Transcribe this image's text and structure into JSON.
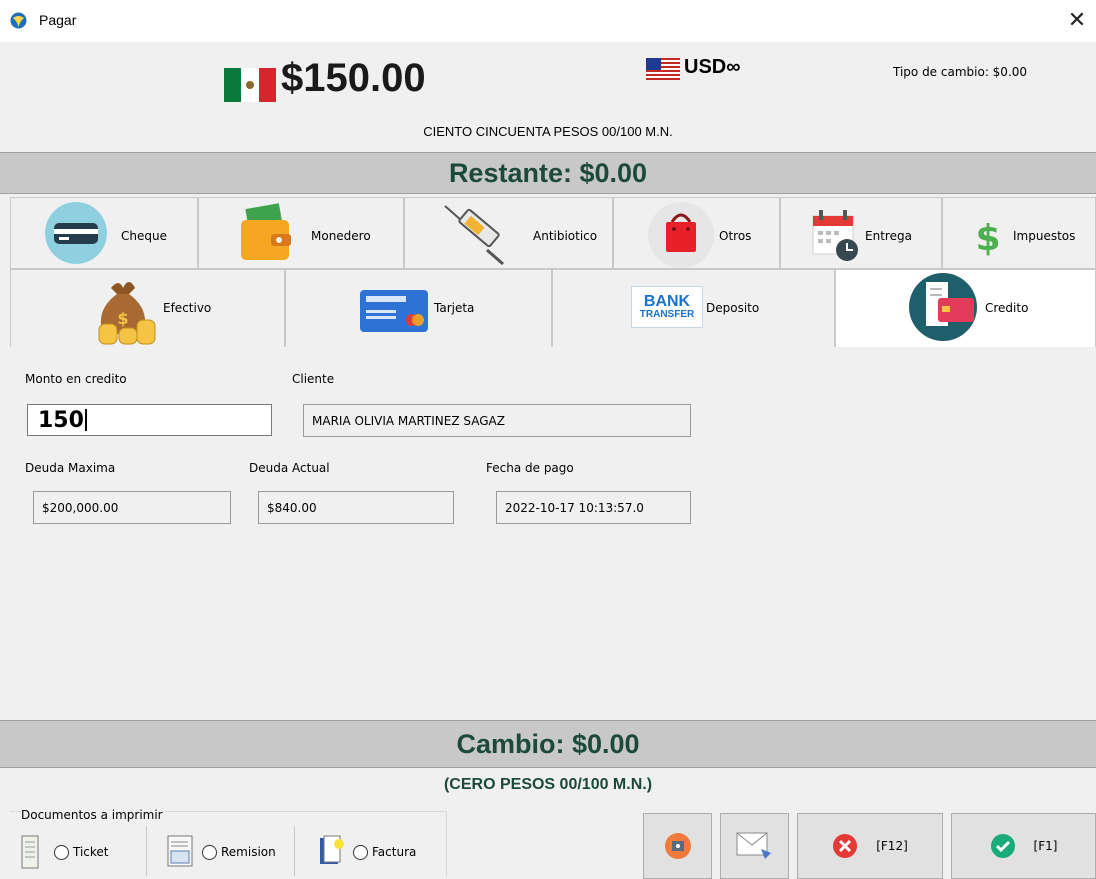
{
  "window": {
    "title": "Pagar",
    "close_glyph": "✕"
  },
  "header": {
    "total": "$150.00",
    "currency": "USD∞",
    "exchange_rate": "Tipo de cambio: $0.00",
    "amount_words": "CIENTO CINCUENTA PESOS  00/100 M.N."
  },
  "restante": "Restante: $0.00",
  "tabs_top": [
    {
      "label": "Cheque",
      "icon": "check-card-icon"
    },
    {
      "label": "Monedero",
      "icon": "wallet-icon"
    },
    {
      "label": "Antibiotico",
      "icon": "syringe-icon"
    },
    {
      "label": "Otros",
      "icon": "shopping-bag-icon"
    },
    {
      "label": "Entrega",
      "icon": "calendar-clock-icon"
    },
    {
      "label": "Impuestos",
      "icon": "dollar-icon"
    }
  ],
  "tabs_bottom": [
    {
      "label": "Efectivo",
      "icon": "money-bag-icon"
    },
    {
      "label": "Tarjeta",
      "icon": "credit-card-icon"
    },
    {
      "label": "Deposito",
      "icon": "bank-transfer-icon",
      "badge_top": "BANK",
      "badge_bottom": "TRANSFER"
    },
    {
      "label": "Credito",
      "icon": "credit-receipt-icon",
      "active": true
    }
  ],
  "credit": {
    "amount_label": "Monto en credito",
    "amount_value": "150",
    "client_label": "Cliente",
    "client_value": "MARIA OLIVIA MARTINEZ SAGAZ",
    "max_debt_label": "Deuda Maxima",
    "max_debt_value": "$200,000.00",
    "current_debt_label": "Deuda Actual",
    "current_debt_value": "$840.00",
    "pay_date_label": "Fecha de pago",
    "pay_date_value": "2022-10-17 10:13:57.0"
  },
  "cambio": "Cambio: $0.00",
  "cambio_words": "(CERO PESOS  00/100 M.N.)",
  "documents": {
    "title": "Documentos a imprimir",
    "options": [
      "Ticket",
      "Remision",
      "Factura"
    ]
  },
  "buttons": {
    "cancel": "[F12]",
    "accept": "[F1]"
  },
  "colors": {
    "accent": "#1c4a3a",
    "bar": "#c8c8c8",
    "cancel": "#e53935",
    "accept": "#1aab7a"
  }
}
